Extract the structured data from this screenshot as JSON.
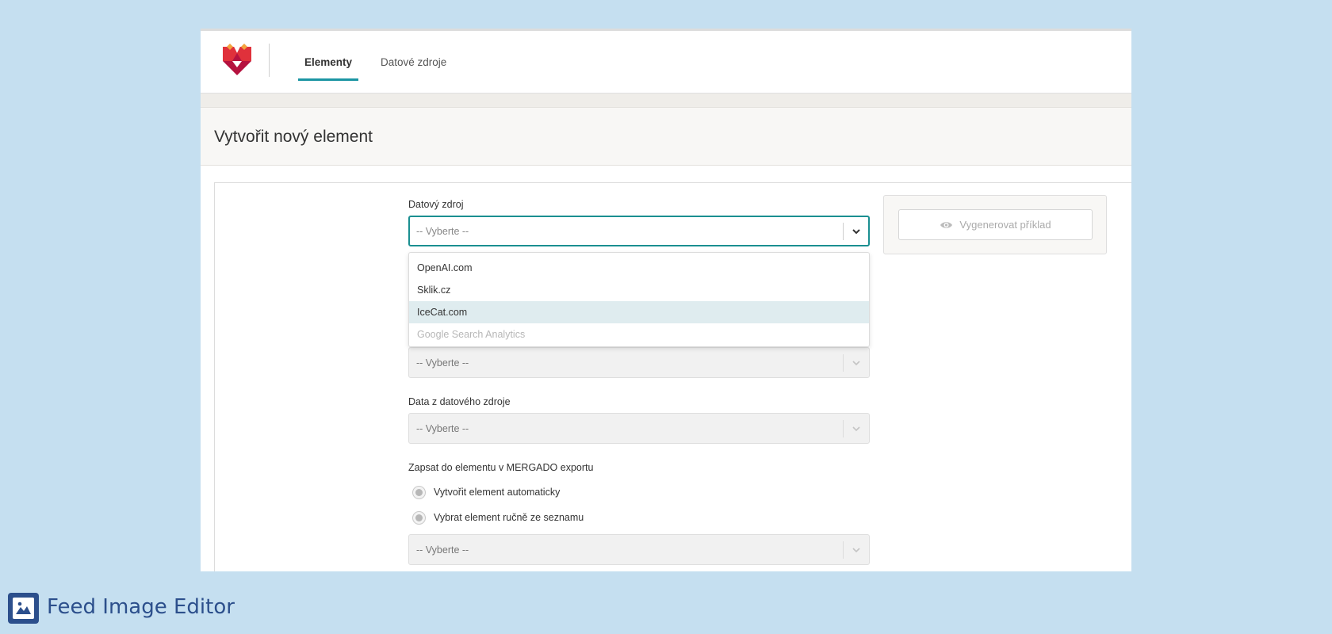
{
  "nav": {
    "tabs": [
      {
        "label": "Elementy",
        "active": true
      },
      {
        "label": "Datové zdroje",
        "active": false
      }
    ]
  },
  "page": {
    "title": "Vytvořit nový element"
  },
  "form": {
    "data_source": {
      "label": "Datový zdroj",
      "placeholder": "-- Vyberte --",
      "options": [
        {
          "label": "OpenAI.com",
          "state": "normal"
        },
        {
          "label": "Sklik.cz",
          "state": "normal"
        },
        {
          "label": "IceCat.com",
          "state": "highlighted"
        },
        {
          "label": "Google Search Analytics",
          "state": "disabled"
        }
      ]
    },
    "hidden_select": {
      "value": "-- Vyberte --"
    },
    "source_data": {
      "label": "Data z datového zdroje",
      "value": "-- Vyberte --"
    },
    "write_to": {
      "label": "Zapsat do elementu v MERGADO exportu",
      "options": [
        "Vytvořit element automaticky",
        "Vybrat element ručně ze seznamu"
      ]
    },
    "element_select": {
      "value": "-- Vyberte --"
    }
  },
  "preview": {
    "button_label": "Vygenerovat příklad"
  },
  "footer": {
    "title": "Feed Image Editor"
  },
  "colors": {
    "accent": "#1b95a3",
    "brand_red": "#e0313b",
    "brand_dark": "#b5123f",
    "footer_blue": "#2c4f8c",
    "background": "#c5dff0"
  }
}
